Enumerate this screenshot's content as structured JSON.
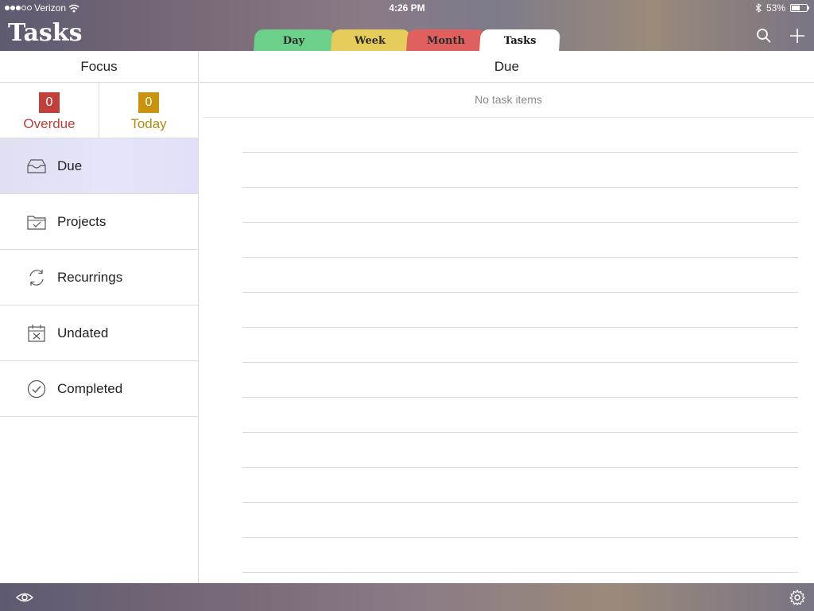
{
  "status_bar": {
    "carrier": "Verizon",
    "time": "4:26 PM",
    "battery_percent": "53%",
    "battery_level": 0.53
  },
  "header": {
    "title": "Tasks",
    "tabs": [
      {
        "label": "Day",
        "color": "#6ccf8a"
      },
      {
        "label": "Week",
        "color": "#e6cc5a"
      },
      {
        "label": "Month",
        "color": "#e06060"
      },
      {
        "label": "Tasks",
        "color": "#ffffff",
        "selected": true
      }
    ],
    "icons": [
      "search-icon",
      "plus-icon"
    ]
  },
  "sidebar": {
    "focus_title": "Focus",
    "counters": [
      {
        "count": "0",
        "label": "Overdue",
        "color": "#c0403c"
      },
      {
        "count": "0",
        "label": "Today",
        "color": "#c9920f"
      }
    ],
    "items": [
      {
        "label": "Due",
        "icon": "inbox-tray-icon",
        "selected": true
      },
      {
        "label": "Projects",
        "icon": "folder-check-icon"
      },
      {
        "label": "Recurrings",
        "icon": "repeat-arrows-icon"
      },
      {
        "label": "Undated",
        "icon": "calendar-x-icon"
      },
      {
        "label": "Completed",
        "icon": "check-circle-icon"
      }
    ]
  },
  "main": {
    "title": "Due",
    "empty_message": "No task items"
  },
  "bottom_bar": {
    "icons": [
      "eye-icon",
      "gear-icon"
    ]
  }
}
